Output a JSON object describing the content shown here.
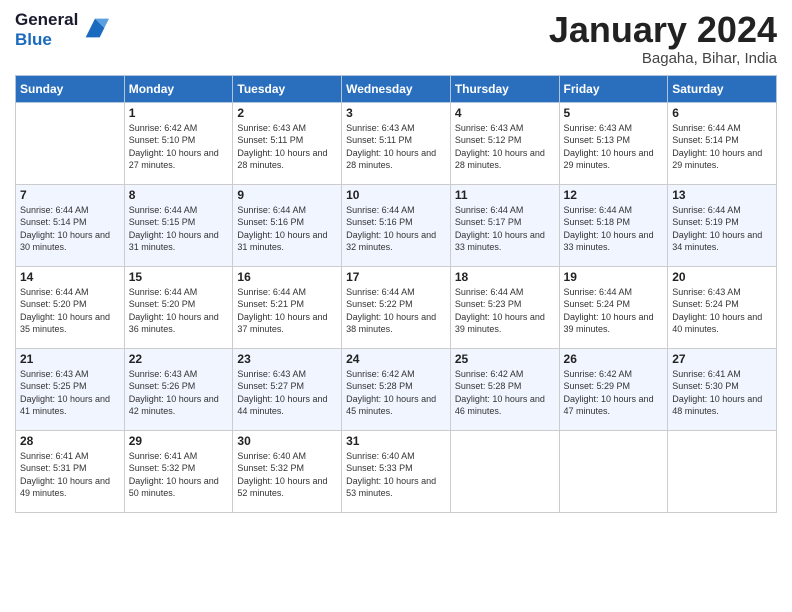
{
  "logo": {
    "general": "General",
    "blue": "Blue"
  },
  "header": {
    "month": "January 2024",
    "location": "Bagaha, Bihar, India"
  },
  "weekdays": [
    "Sunday",
    "Monday",
    "Tuesday",
    "Wednesday",
    "Thursday",
    "Friday",
    "Saturday"
  ],
  "weeks": [
    [
      {
        "day": "",
        "sunrise": "",
        "sunset": "",
        "daylight": ""
      },
      {
        "day": "1",
        "sunrise": "Sunrise: 6:42 AM",
        "sunset": "Sunset: 5:10 PM",
        "daylight": "Daylight: 10 hours and 27 minutes."
      },
      {
        "day": "2",
        "sunrise": "Sunrise: 6:43 AM",
        "sunset": "Sunset: 5:11 PM",
        "daylight": "Daylight: 10 hours and 28 minutes."
      },
      {
        "day": "3",
        "sunrise": "Sunrise: 6:43 AM",
        "sunset": "Sunset: 5:11 PM",
        "daylight": "Daylight: 10 hours and 28 minutes."
      },
      {
        "day": "4",
        "sunrise": "Sunrise: 6:43 AM",
        "sunset": "Sunset: 5:12 PM",
        "daylight": "Daylight: 10 hours and 28 minutes."
      },
      {
        "day": "5",
        "sunrise": "Sunrise: 6:43 AM",
        "sunset": "Sunset: 5:13 PM",
        "daylight": "Daylight: 10 hours and 29 minutes."
      },
      {
        "day": "6",
        "sunrise": "Sunrise: 6:44 AM",
        "sunset": "Sunset: 5:14 PM",
        "daylight": "Daylight: 10 hours and 29 minutes."
      }
    ],
    [
      {
        "day": "7",
        "sunrise": "Sunrise: 6:44 AM",
        "sunset": "Sunset: 5:14 PM",
        "daylight": "Daylight: 10 hours and 30 minutes."
      },
      {
        "day": "8",
        "sunrise": "Sunrise: 6:44 AM",
        "sunset": "Sunset: 5:15 PM",
        "daylight": "Daylight: 10 hours and 31 minutes."
      },
      {
        "day": "9",
        "sunrise": "Sunrise: 6:44 AM",
        "sunset": "Sunset: 5:16 PM",
        "daylight": "Daylight: 10 hours and 31 minutes."
      },
      {
        "day": "10",
        "sunrise": "Sunrise: 6:44 AM",
        "sunset": "Sunset: 5:16 PM",
        "daylight": "Daylight: 10 hours and 32 minutes."
      },
      {
        "day": "11",
        "sunrise": "Sunrise: 6:44 AM",
        "sunset": "Sunset: 5:17 PM",
        "daylight": "Daylight: 10 hours and 33 minutes."
      },
      {
        "day": "12",
        "sunrise": "Sunrise: 6:44 AM",
        "sunset": "Sunset: 5:18 PM",
        "daylight": "Daylight: 10 hours and 33 minutes."
      },
      {
        "day": "13",
        "sunrise": "Sunrise: 6:44 AM",
        "sunset": "Sunset: 5:19 PM",
        "daylight": "Daylight: 10 hours and 34 minutes."
      }
    ],
    [
      {
        "day": "14",
        "sunrise": "Sunrise: 6:44 AM",
        "sunset": "Sunset: 5:20 PM",
        "daylight": "Daylight: 10 hours and 35 minutes."
      },
      {
        "day": "15",
        "sunrise": "Sunrise: 6:44 AM",
        "sunset": "Sunset: 5:20 PM",
        "daylight": "Daylight: 10 hours and 36 minutes."
      },
      {
        "day": "16",
        "sunrise": "Sunrise: 6:44 AM",
        "sunset": "Sunset: 5:21 PM",
        "daylight": "Daylight: 10 hours and 37 minutes."
      },
      {
        "day": "17",
        "sunrise": "Sunrise: 6:44 AM",
        "sunset": "Sunset: 5:22 PM",
        "daylight": "Daylight: 10 hours and 38 minutes."
      },
      {
        "day": "18",
        "sunrise": "Sunrise: 6:44 AM",
        "sunset": "Sunset: 5:23 PM",
        "daylight": "Daylight: 10 hours and 39 minutes."
      },
      {
        "day": "19",
        "sunrise": "Sunrise: 6:44 AM",
        "sunset": "Sunset: 5:24 PM",
        "daylight": "Daylight: 10 hours and 39 minutes."
      },
      {
        "day": "20",
        "sunrise": "Sunrise: 6:43 AM",
        "sunset": "Sunset: 5:24 PM",
        "daylight": "Daylight: 10 hours and 40 minutes."
      }
    ],
    [
      {
        "day": "21",
        "sunrise": "Sunrise: 6:43 AM",
        "sunset": "Sunset: 5:25 PM",
        "daylight": "Daylight: 10 hours and 41 minutes."
      },
      {
        "day": "22",
        "sunrise": "Sunrise: 6:43 AM",
        "sunset": "Sunset: 5:26 PM",
        "daylight": "Daylight: 10 hours and 42 minutes."
      },
      {
        "day": "23",
        "sunrise": "Sunrise: 6:43 AM",
        "sunset": "Sunset: 5:27 PM",
        "daylight": "Daylight: 10 hours and 44 minutes."
      },
      {
        "day": "24",
        "sunrise": "Sunrise: 6:42 AM",
        "sunset": "Sunset: 5:28 PM",
        "daylight": "Daylight: 10 hours and 45 minutes."
      },
      {
        "day": "25",
        "sunrise": "Sunrise: 6:42 AM",
        "sunset": "Sunset: 5:28 PM",
        "daylight": "Daylight: 10 hours and 46 minutes."
      },
      {
        "day": "26",
        "sunrise": "Sunrise: 6:42 AM",
        "sunset": "Sunset: 5:29 PM",
        "daylight": "Daylight: 10 hours and 47 minutes."
      },
      {
        "day": "27",
        "sunrise": "Sunrise: 6:41 AM",
        "sunset": "Sunset: 5:30 PM",
        "daylight": "Daylight: 10 hours and 48 minutes."
      }
    ],
    [
      {
        "day": "28",
        "sunrise": "Sunrise: 6:41 AM",
        "sunset": "Sunset: 5:31 PM",
        "daylight": "Daylight: 10 hours and 49 minutes."
      },
      {
        "day": "29",
        "sunrise": "Sunrise: 6:41 AM",
        "sunset": "Sunset: 5:32 PM",
        "daylight": "Daylight: 10 hours and 50 minutes."
      },
      {
        "day": "30",
        "sunrise": "Sunrise: 6:40 AM",
        "sunset": "Sunset: 5:32 PM",
        "daylight": "Daylight: 10 hours and 52 minutes."
      },
      {
        "day": "31",
        "sunrise": "Sunrise: 6:40 AM",
        "sunset": "Sunset: 5:33 PM",
        "daylight": "Daylight: 10 hours and 53 minutes."
      },
      {
        "day": "",
        "sunrise": "",
        "sunset": "",
        "daylight": ""
      },
      {
        "day": "",
        "sunrise": "",
        "sunset": "",
        "daylight": ""
      },
      {
        "day": "",
        "sunrise": "",
        "sunset": "",
        "daylight": ""
      }
    ]
  ]
}
